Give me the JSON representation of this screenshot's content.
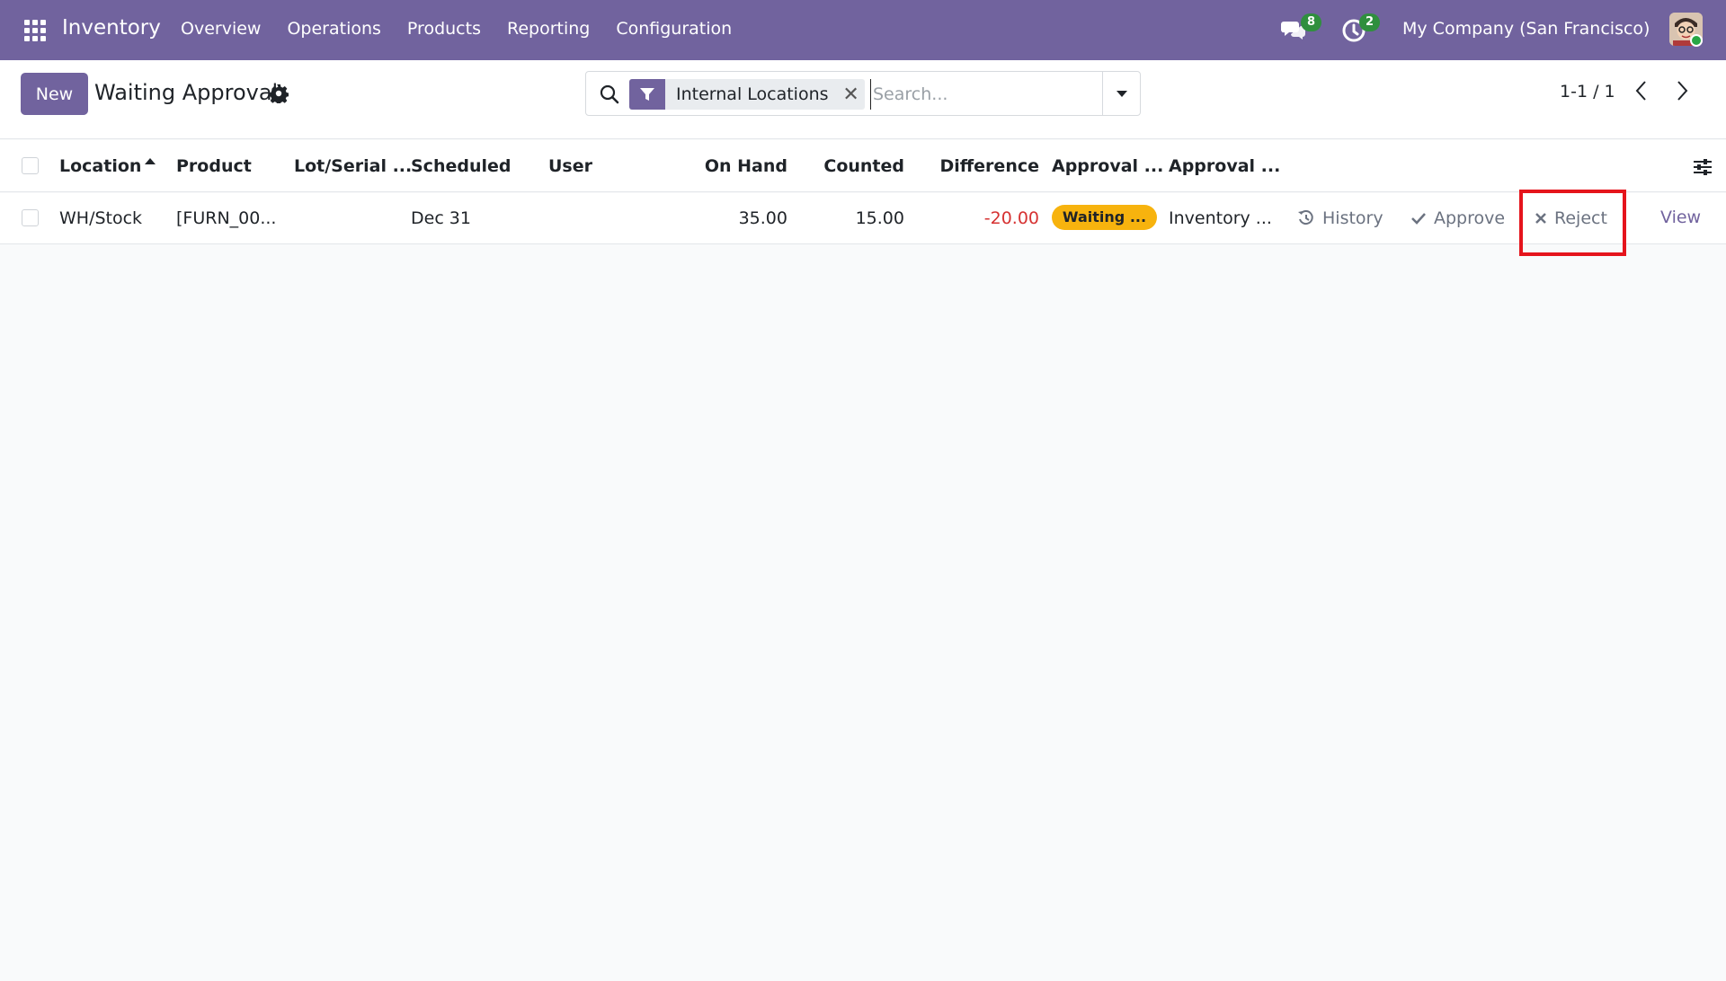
{
  "navbar": {
    "brand": "Inventory",
    "menu": [
      "Overview",
      "Operations",
      "Products",
      "Reporting",
      "Configuration"
    ],
    "messages_count": "8",
    "activities_count": "2",
    "company": "My Company (San Francisco)",
    "icons": [
      "apps-grid-icon",
      "chat-icon",
      "clock-icon",
      "avatar"
    ]
  },
  "control": {
    "new_label": "New",
    "title": "Waiting Approval",
    "facet_label": "Internal Locations",
    "search_placeholder": "Search...",
    "pager": "1-1 / 1"
  },
  "table": {
    "columns": [
      "Location",
      "Product",
      "Lot/Serial ...",
      "Scheduled",
      "User",
      "On Hand",
      "Counted",
      "Difference",
      "Approval ...",
      "Approval ..."
    ],
    "rows": [
      {
        "location": "WH/Stock",
        "product": "[FURN_00...",
        "lot": "",
        "scheduled": "Dec 31",
        "user": "",
        "on_hand": "35.00",
        "counted": "15.00",
        "difference": "-20.00",
        "approval_state": "Waiting ...",
        "approval_user": "Inventory ...",
        "history_label": "History",
        "approve_label": "Approve",
        "reject_label": "Reject",
        "view_label": "View"
      }
    ]
  },
  "colors": {
    "brand": "#71639e",
    "status_waiting": "#f7b30e",
    "negative": "#d63232",
    "highlight": "#e5141c",
    "badge": "#2f8f3e"
  }
}
